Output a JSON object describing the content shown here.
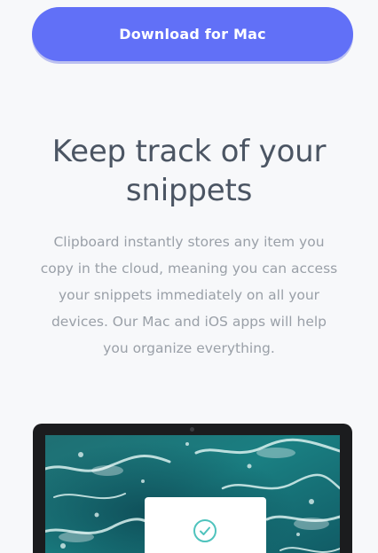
{
  "hero": {
    "download_button_label": "Download for Mac"
  },
  "section": {
    "headline": "Keep track of your snippets",
    "description": "Clipboard instantly stores any item you copy in the cloud, meaning you can access your snippets immediately on all your devices. Our Mac and iOS apps will help you organize everything."
  },
  "colors": {
    "accent": "#6170f7",
    "headline": "#4b5563",
    "body_text": "#9aa0a8",
    "check": "#4fc3bd"
  },
  "icons": {
    "device_card_icon": "check-circle-icon"
  }
}
